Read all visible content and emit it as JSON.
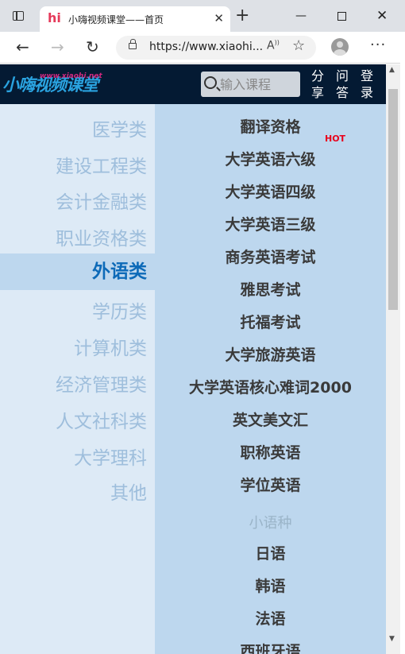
{
  "browser": {
    "tab": {
      "favicon": "hi",
      "title": "小嗨视频课堂——首页",
      "close": "✕"
    },
    "new_tab": "+",
    "url": "https://www.xiaohi...",
    "icons": [
      "tabs-icon",
      "close-icon",
      "plus-icon",
      "minimize-icon",
      "maximize-icon",
      "back-arrow-icon",
      "forward-arrow-icon",
      "reload-icon",
      "lock-icon",
      "read-aloud-icon",
      "add-favorite-icon",
      "profile-icon",
      "more-icon"
    ]
  },
  "header": {
    "logo_text": "小嗨视频课堂",
    "logo_url": "www.xiaohi.net",
    "search_placeholder": "输入课程",
    "links": {
      "share": "分享",
      "qa": "问答",
      "login": "登录"
    }
  },
  "left_nav": {
    "items": [
      "医学类",
      "建设工程类",
      "会计金融类",
      "职业资格类",
      "外语类",
      "学历类",
      "计算机类",
      "经济管理类",
      "人文社科类",
      "大学理科",
      "其他"
    ],
    "active": "外语类"
  },
  "courses": {
    "items": [
      "翻译资格",
      "大学英语六级",
      "大学英语四级",
      "大学英语三级",
      "商务英语考试",
      "雅思考试",
      "托福考试",
      "大学旅游英语",
      "大学英语核心难词2000",
      "英文美文汇",
      "职称英语",
      "学位英语"
    ],
    "hot_badge": "HOT",
    "minor_heading": "小语种",
    "minor_items": [
      "日语",
      "韩语",
      "法语",
      "西班牙语"
    ]
  },
  "colors": {
    "header_bg": "#041a33",
    "left_nav_bg": "#ddeaf6",
    "content_bg": "#bdd7ee",
    "active_text": "#0d6ab8",
    "inactive_text": "#9ebedc",
    "hot": "#e8001c"
  }
}
